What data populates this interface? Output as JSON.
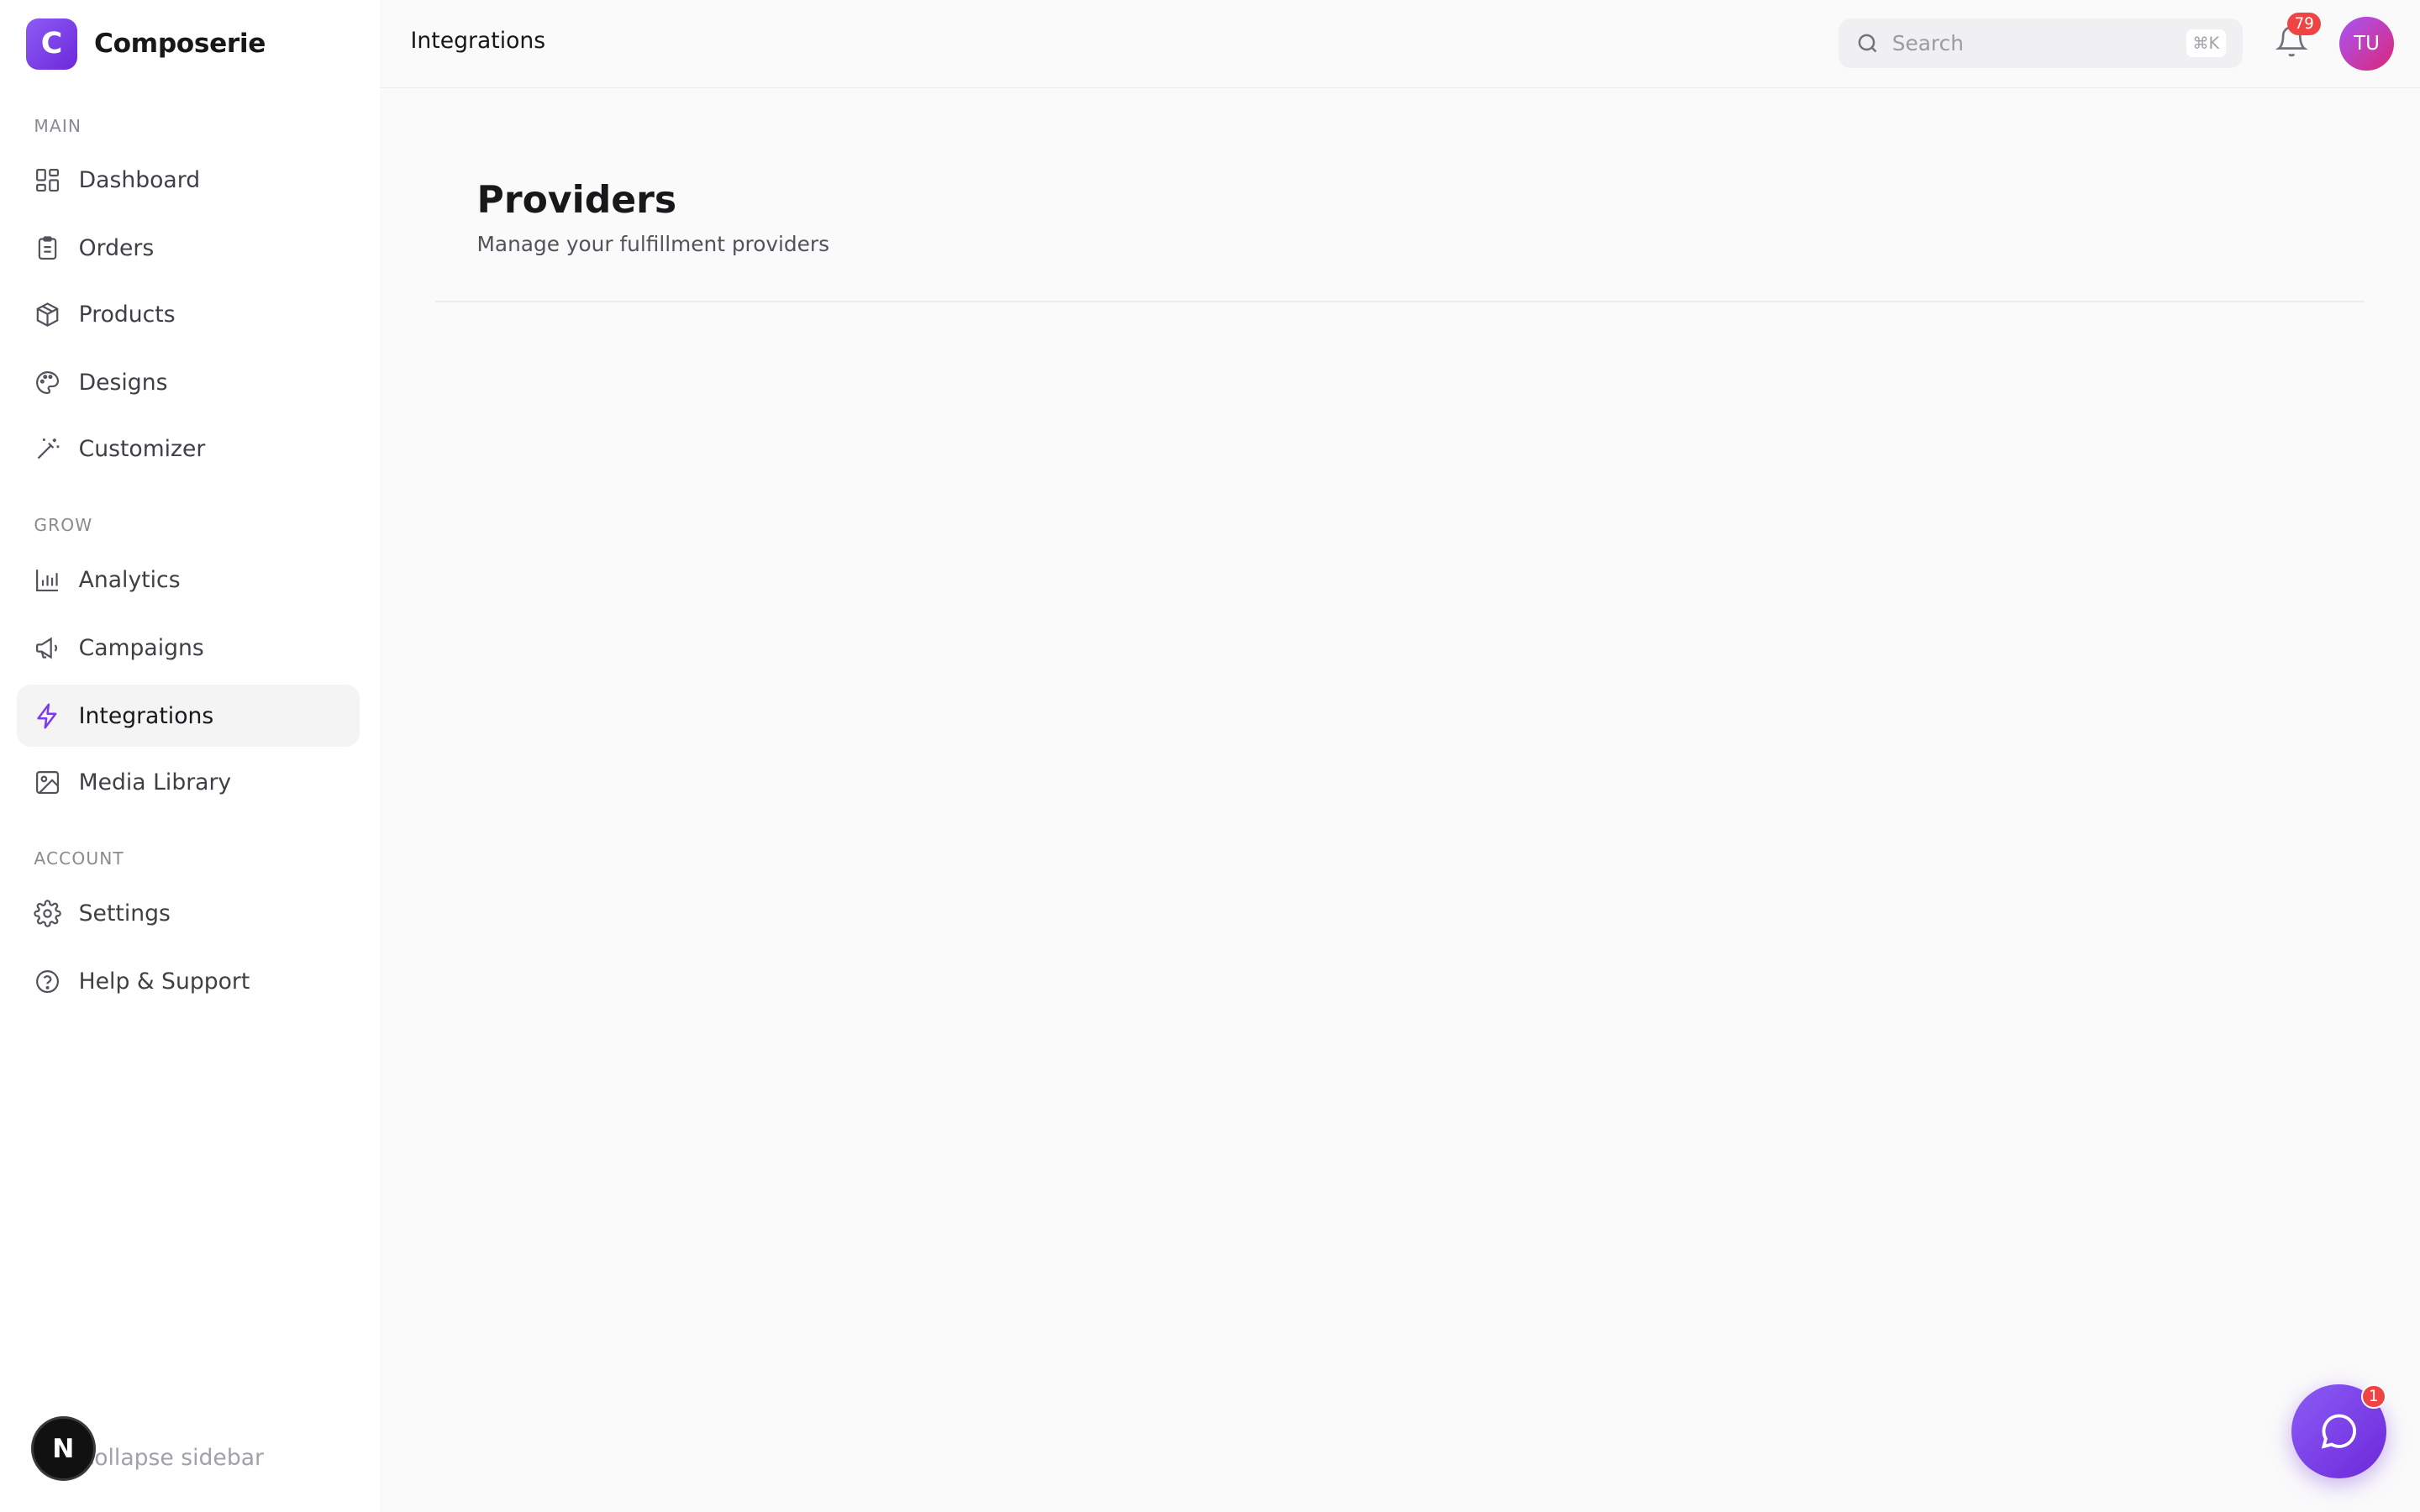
{
  "brand": {
    "logo_letter": "C",
    "name": "Composerie",
    "accent": "#7c3aed"
  },
  "sidebar": {
    "sections": [
      {
        "label": "MAIN",
        "items": [
          {
            "label": "Dashboard",
            "icon": "dashboard-icon"
          },
          {
            "label": "Orders",
            "icon": "clipboard-icon"
          },
          {
            "label": "Products",
            "icon": "box-icon"
          },
          {
            "label": "Designs",
            "icon": "palette-icon"
          },
          {
            "label": "Customizer",
            "icon": "wand-icon"
          }
        ]
      },
      {
        "label": "GROW",
        "items": [
          {
            "label": "Analytics",
            "icon": "bar-chart-icon"
          },
          {
            "label": "Campaigns",
            "icon": "megaphone-icon"
          },
          {
            "label": "Integrations",
            "icon": "bolt-icon",
            "active": true
          },
          {
            "label": "Media Library",
            "icon": "image-icon"
          }
        ]
      },
      {
        "label": "ACCOUNT",
        "items": [
          {
            "label": "Settings",
            "icon": "gear-icon"
          },
          {
            "label": "Help & Support",
            "icon": "help-circle-icon"
          }
        ]
      }
    ],
    "collapse_label": "Collapse sidebar",
    "n_badge": "N"
  },
  "topbar": {
    "title": "Integrations",
    "search": {
      "placeholder": "Search",
      "shortcut": "⌘K"
    },
    "notifications_count": "79",
    "avatar_initials": "TU"
  },
  "page": {
    "title": "Providers",
    "subtitle": "Manage your fulfillment providers"
  },
  "chat": {
    "badge_count": "1"
  }
}
